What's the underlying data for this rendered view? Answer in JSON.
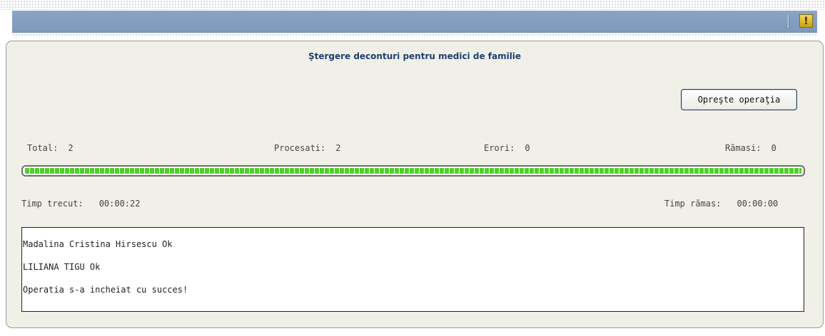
{
  "header": {
    "warning_glyph": "!"
  },
  "panel": {
    "title": "Ştergere deconturi pentru medici de familie",
    "stop_button_label": "Opreşte operaţia"
  },
  "stats": {
    "total_label": "Total:",
    "total_value": "2",
    "processed_label": "Procesati:",
    "processed_value": "2",
    "errors_label": "Erori:",
    "errors_value": "0",
    "remaining_label": "Rămasi:",
    "remaining_value": "0"
  },
  "progress": {
    "percent": 100,
    "color": "#4ed028"
  },
  "time": {
    "elapsed_label": "Timp trecut:",
    "elapsed_value": "00:00:22",
    "remaining_label": "Timp rămas:",
    "remaining_value": "00:00:00"
  },
  "log": {
    "lines": [
      "Madalina Cristina Hirsescu Ok",
      "LILIANA TIGU Ok",
      "Operatia s-a incheiat cu succes!"
    ]
  },
  "colors": {
    "title_bar": "#7d99bb",
    "panel_bg": "#f1f0e8",
    "title_text": "#1f3f72"
  }
}
